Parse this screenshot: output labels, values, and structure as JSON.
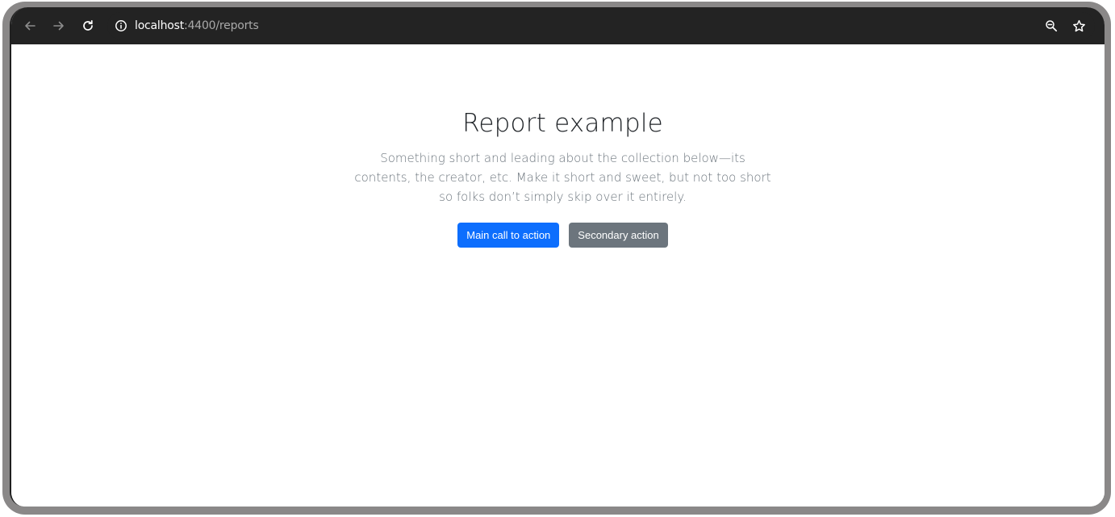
{
  "browser": {
    "url_host": "localhost",
    "url_rest": ":4400/reports",
    "icons": {
      "back": "arrow-left-icon",
      "forward": "arrow-right-icon",
      "reload": "reload-icon",
      "site_info": "info-icon",
      "zoom": "zoom-out-icon",
      "bookmark": "star-icon"
    }
  },
  "hero": {
    "title": "Report example",
    "lead": "Something short and leading about the collection below—its contents, the creator, etc. Make it short and sweet, but not too short so folks don’t simply skip over it entirely.",
    "primary_label": "Main call to action",
    "secondary_label": "Secondary action"
  },
  "colors": {
    "primary": "#0d6efd",
    "secondary": "#6c757d",
    "toolbar": "#232323"
  }
}
